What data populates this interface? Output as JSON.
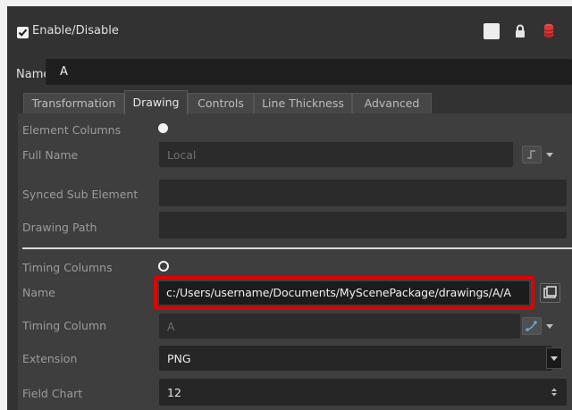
{
  "header": {
    "enable_label": "Enable/Disable",
    "enabled": true
  },
  "name_row": {
    "label": "Name:",
    "value": "A"
  },
  "tabs": [
    {
      "label": "Transformation",
      "active": false
    },
    {
      "label": "Drawing",
      "active": true
    },
    {
      "label": "Controls",
      "active": false
    },
    {
      "label": "Line Thickness",
      "active": false
    },
    {
      "label": "Advanced",
      "active": false
    }
  ],
  "element_columns": {
    "label": "Element Columns",
    "full_name_label": "Full Name",
    "full_name_value": "Local",
    "synced_sub_element_label": "Synced Sub Element",
    "synced_sub_element_value": "",
    "drawing_path_label": "Drawing Path",
    "drawing_path_value": ""
  },
  "timing_columns": {
    "label": "Timing Columns",
    "name_label": "Name",
    "name_value": "c:/Users/username/Documents/MyScenePackage/drawings/A/A",
    "timing_column_label": "Timing Column",
    "timing_column_value": "A",
    "extension_label": "Extension",
    "extension_value": "PNG",
    "field_chart_label": "Field Chart",
    "field_chart_value": "12"
  },
  "colors": {
    "highlight": "#e00000",
    "panel_bg": "#323232",
    "content_bg": "#3e3e3e",
    "db_icon": "#d83a3a"
  },
  "icons": {
    "header_right": [
      "white-square-icon",
      "lock-icon",
      "database-icon"
    ],
    "full_name_btn": "link-curve-icon",
    "timing_column_btn": "function-curve-icon",
    "name_btn": "browse-folder-icon"
  }
}
